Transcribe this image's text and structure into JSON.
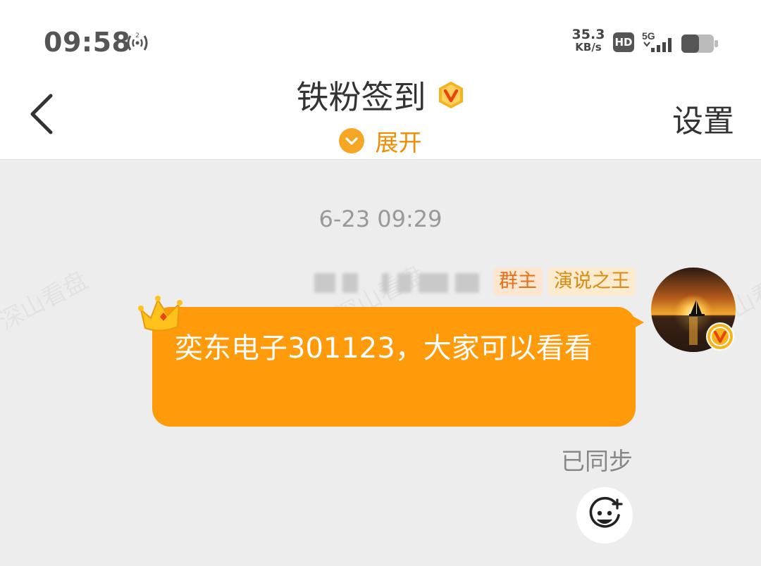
{
  "status_bar": {
    "time": "09:58",
    "net_speed_value": "35.3",
    "net_speed_unit": "KB/s",
    "hd_label": "HD",
    "network_type": "5G",
    "battery_level": 0.55,
    "nfc_label": "2"
  },
  "header": {
    "title": "铁粉签到",
    "expand_label": "展开",
    "settings_label": "设置"
  },
  "chat": {
    "watermark_text": "深山看盘",
    "timestamp": "6-23 09:29",
    "message": {
      "badges": [
        "群主",
        "演说之王"
      ],
      "text": "奕东电子301123，大家可以看看",
      "status": "已同步"
    }
  },
  "colors": {
    "accent": "#ff9a0a",
    "badge_owner_bg": "#fde6cf",
    "badge_king_bg": "#fdebd0",
    "background": "#ededed"
  }
}
